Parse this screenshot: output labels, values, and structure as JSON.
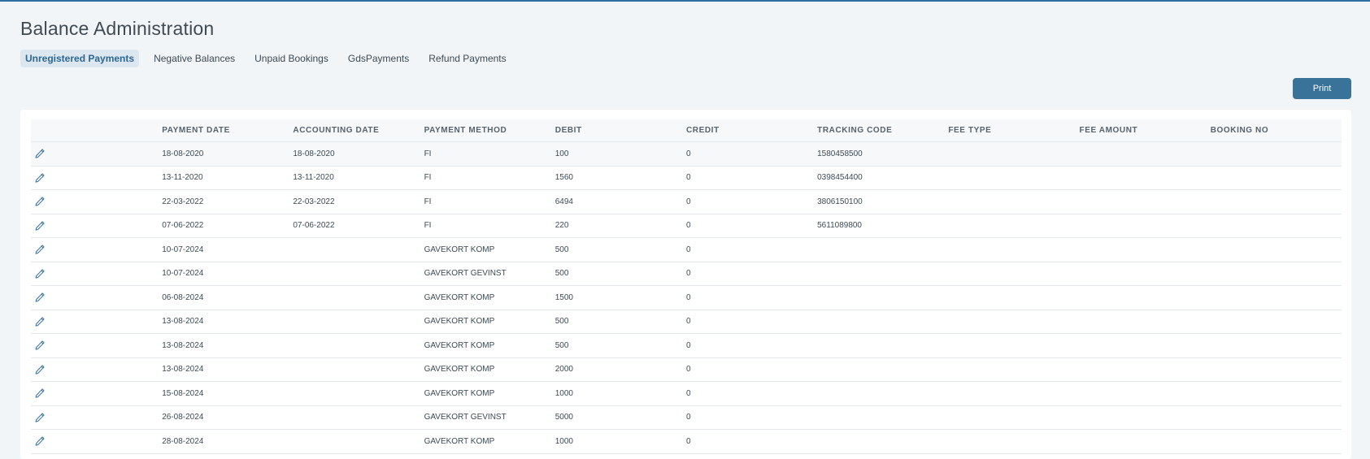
{
  "page": {
    "title": "Balance Administration"
  },
  "tabs": [
    {
      "label": "Unregistered Payments",
      "active": true
    },
    {
      "label": "Negative Balances",
      "active": false
    },
    {
      "label": "Unpaid Bookings",
      "active": false
    },
    {
      "label": "GdsPayments",
      "active": false
    },
    {
      "label": "Refund Payments",
      "active": false
    }
  ],
  "toolbar": {
    "print_label": "Print"
  },
  "table": {
    "columns": [
      "",
      "PAYMENT DATE",
      "ACCOUNTING DATE",
      "PAYMENT METHOD",
      "DEBIT",
      "CREDIT",
      "TRACKING CODE",
      "FEE TYPE",
      "FEE AMOUNT",
      "BOOKING NO"
    ],
    "rows": [
      [
        "18-08-2020",
        "18-08-2020",
        "FI",
        "100",
        "0",
        "1580458500",
        "",
        "",
        ""
      ],
      [
        "13-11-2020",
        "13-11-2020",
        "FI",
        "1560",
        "0",
        "0398454400",
        "",
        "",
        ""
      ],
      [
        "22-03-2022",
        "22-03-2022",
        "FI",
        "6494",
        "0",
        "3806150100",
        "",
        "",
        ""
      ],
      [
        "07-06-2022",
        "07-06-2022",
        "FI",
        "220",
        "0",
        "5611089800",
        "",
        "",
        ""
      ],
      [
        "10-07-2024",
        "",
        "GAVEKORT KOMP",
        "500",
        "0",
        "",
        "",
        "",
        ""
      ],
      [
        "10-07-2024",
        "",
        "GAVEKORT GEVINST",
        "500",
        "0",
        "",
        "",
        "",
        ""
      ],
      [
        "06-08-2024",
        "",
        "GAVEKORT KOMP",
        "1500",
        "0",
        "",
        "",
        "",
        ""
      ],
      [
        "13-08-2024",
        "",
        "GAVEKORT KOMP",
        "500",
        "0",
        "",
        "",
        "",
        ""
      ],
      [
        "13-08-2024",
        "",
        "GAVEKORT KOMP",
        "500",
        "0",
        "",
        "",
        "",
        ""
      ],
      [
        "13-08-2024",
        "",
        "GAVEKORT KOMP",
        "2000",
        "0",
        "",
        "",
        "",
        ""
      ],
      [
        "15-08-2024",
        "",
        "GAVEKORT KOMP",
        "1000",
        "0",
        "",
        "",
        "",
        ""
      ],
      [
        "26-08-2024",
        "",
        "GAVEKORT GEVINST",
        "5000",
        "0",
        "",
        "",
        "",
        ""
      ],
      [
        "28-08-2024",
        "",
        "GAVEKORT KOMP",
        "1000",
        "0",
        "",
        "",
        "",
        ""
      ]
    ]
  },
  "icons": {
    "edit": "pencil-icon"
  },
  "colors": {
    "accent": "#2f6f9f",
    "button": "#3a7399",
    "active_tab_bg": "#dde7ef",
    "active_tab_text": "#2c6793"
  }
}
